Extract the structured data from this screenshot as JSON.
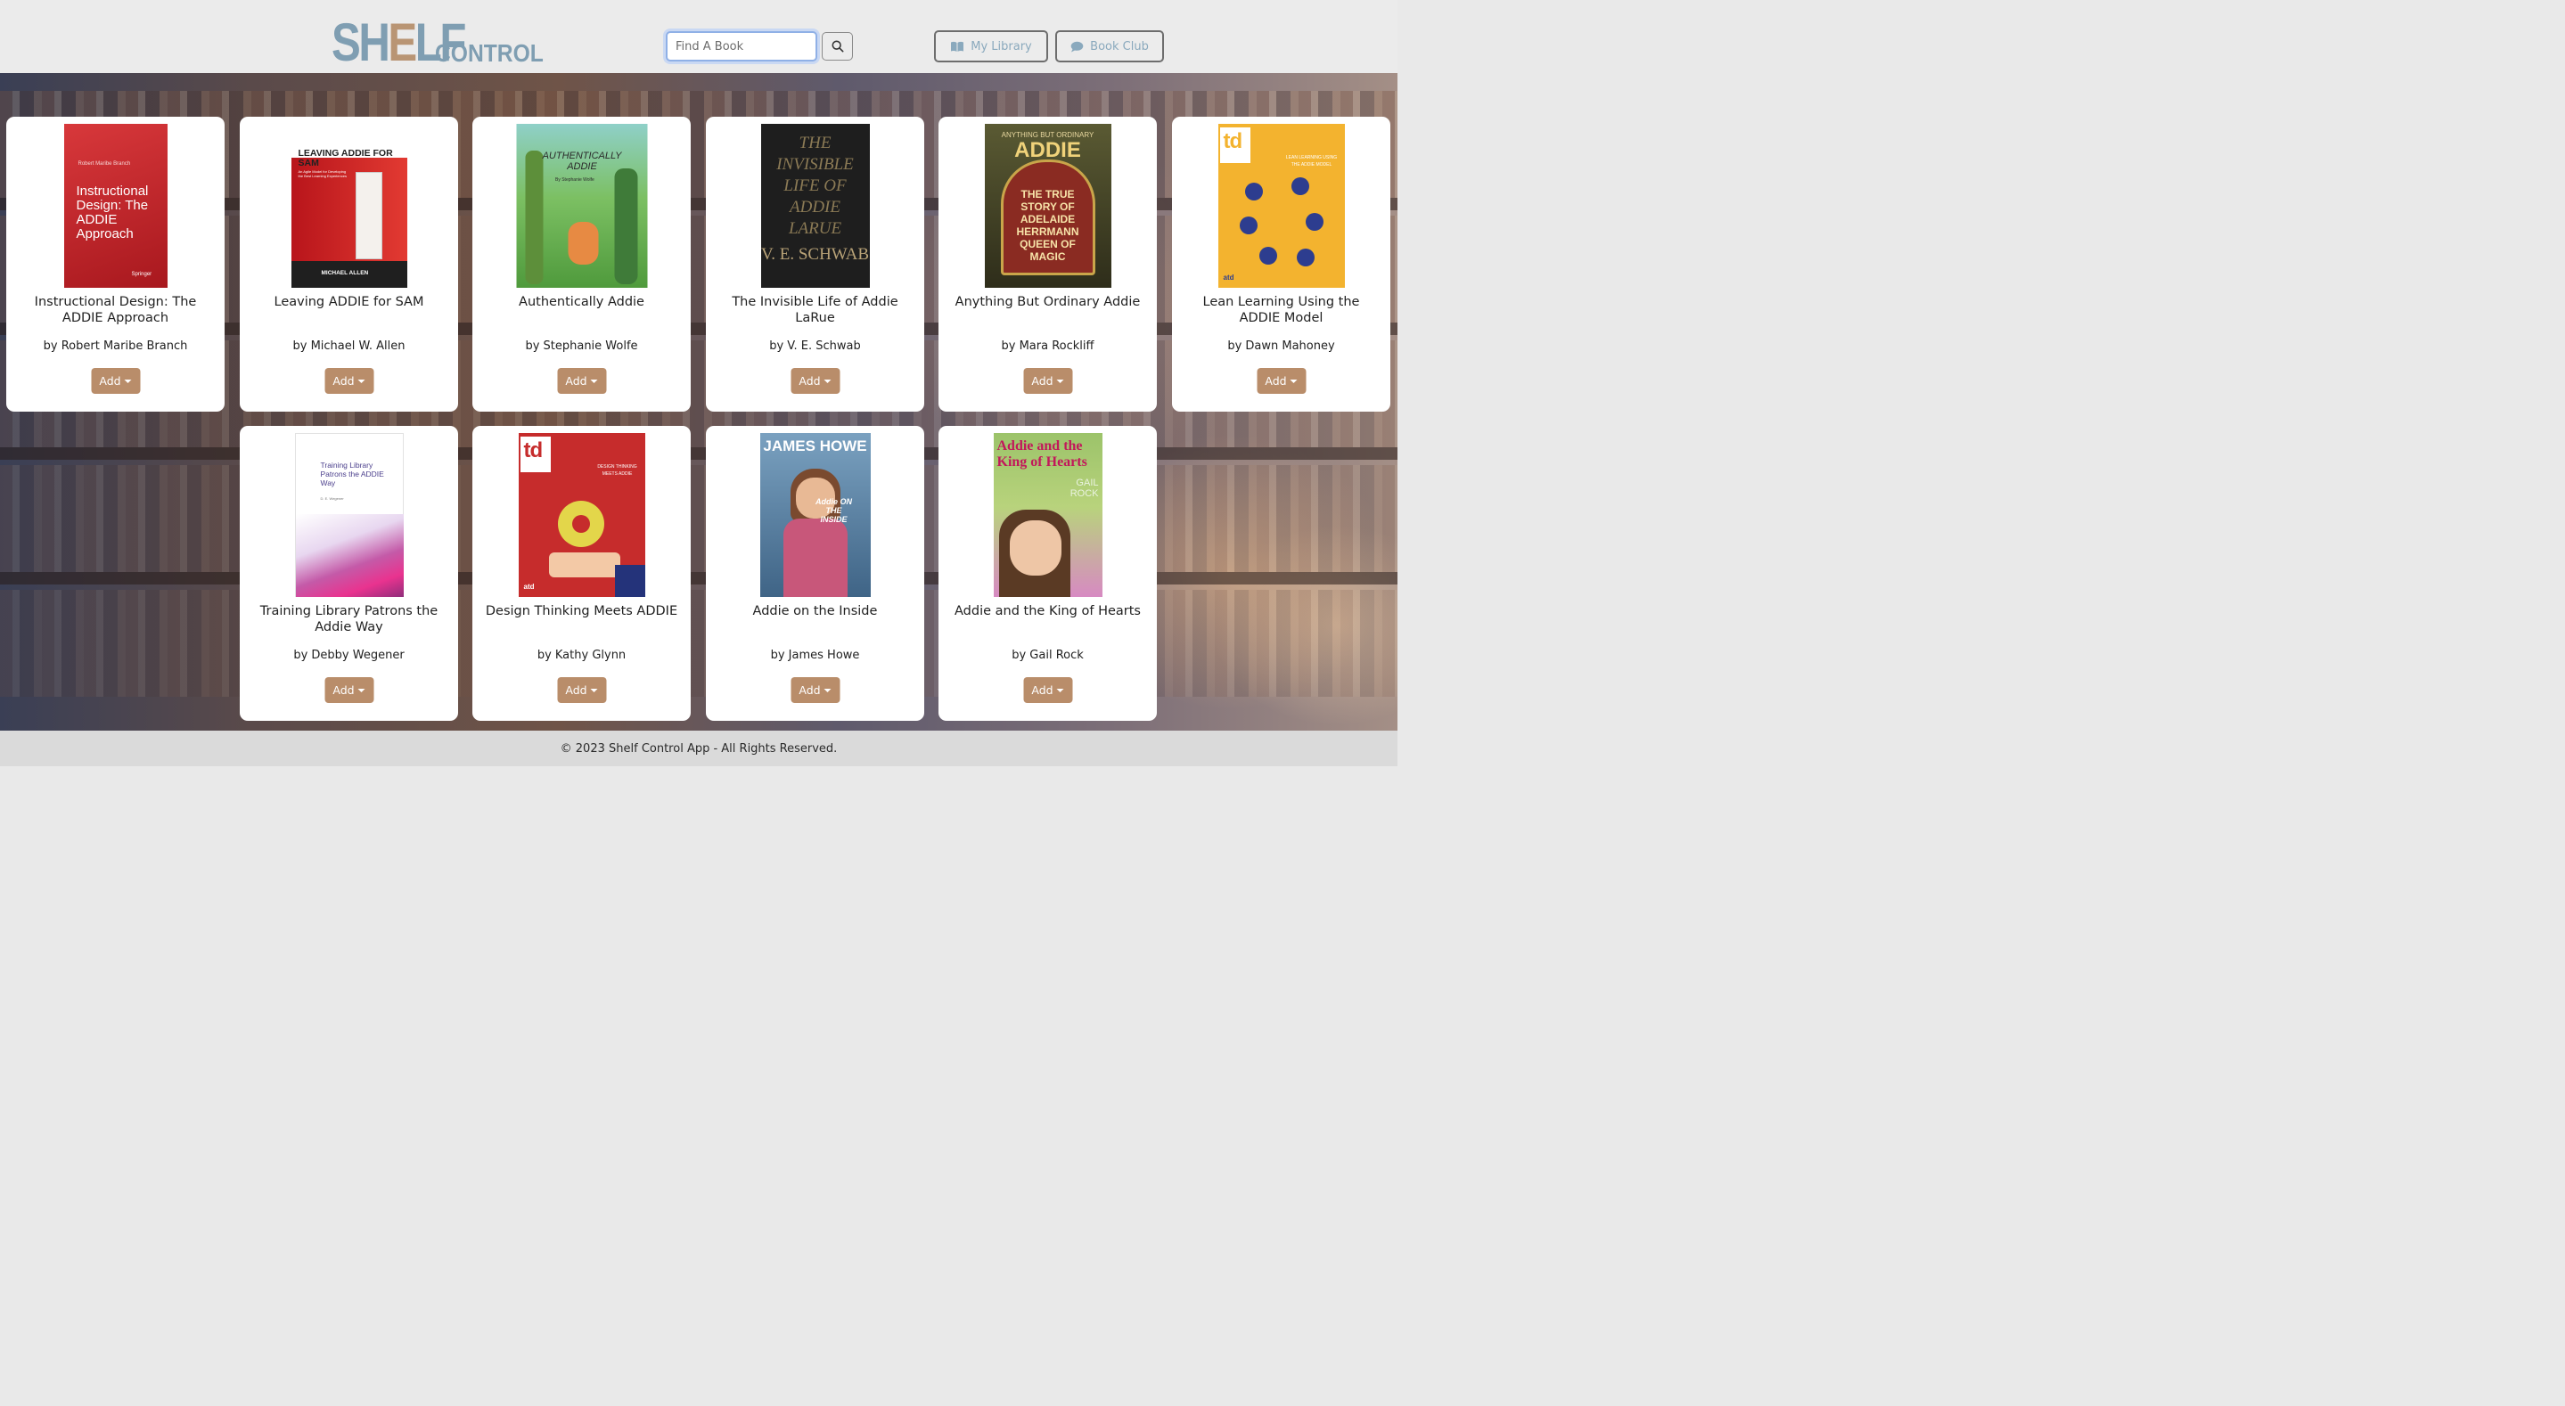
{
  "header": {
    "logo": {
      "big_left": "SH",
      "big_accent": "E",
      "big_right": "LF",
      "small": "CONTROL"
    },
    "search": {
      "placeholder": "Find A Book"
    },
    "nav": [
      {
        "label": "My Library",
        "icon": "book-open-icon"
      },
      {
        "label": "Book Club",
        "icon": "chat-bubble-icon"
      }
    ]
  },
  "books": [
    {
      "title": "Instructional Design: The ADDIE Approach",
      "author": "by Robert Maribe Branch",
      "add_label": "Add",
      "cover": {
        "bg": "#c4262b",
        "header": "Robert Maribe Branch",
        "title": "Instructional Design: The ADDIE Approach",
        "footer": "Springer"
      }
    },
    {
      "title": "Leaving ADDIE for SAM",
      "author": "by Michael W. Allen",
      "add_label": "Add",
      "cover": {
        "bg": "#d32b2b",
        "header": "LEAVING ADDIE FOR SAM",
        "subtitle": "An Agile Model for Developing the Best Learning Experiences",
        "footer": "MICHAEL ALLEN"
      }
    },
    {
      "title": "Authentically Addie",
      "author": "by Stephanie Wolfe",
      "add_label": "Add",
      "cover": {
        "bg": "#6fb45a",
        "header": "AUTHENTICALLY ADDIE",
        "subtitle": "By Stephanie Wolfe"
      }
    },
    {
      "title": "The Invisible Life of Addie LaRue",
      "author": "by V. E. Schwab",
      "add_label": "Add",
      "cover": {
        "bg": "#1c1c1c",
        "header": "THE INVISIBLE LIFE OF ADDIE LARUE",
        "footer": "V. E. SCHWAB"
      }
    },
    {
      "title": "Anything But Ordinary Addie",
      "author": "by Mara Rockliff",
      "add_label": "Add",
      "cover": {
        "bg": "#3d3a22",
        "header": "ANYTHING BUT ORDINARY",
        "title": "ADDIE",
        "subtitle": "THE TRUE STORY OF ADELAIDE HERRMANN QUEEN OF MAGIC"
      }
    },
    {
      "title": "Lean Learning Using the ADDIE Model",
      "author": "by Dawn Mahoney",
      "add_label": "Add",
      "cover": {
        "bg": "#f3b32f",
        "header": "td",
        "subtitle": "LEAN LEARNING USING THE ADDIE MODEL",
        "footer": "atd"
      }
    },
    {
      "title": "Training Library Patrons the Addie Way",
      "author": "by Debby Wegener",
      "add_label": "Add",
      "cover": {
        "bg": "#ffffff",
        "header": "Training Library Patrons the ADDIE Way",
        "subtitle": "D. E. Wegener"
      }
    },
    {
      "title": "Design Thinking Meets ADDIE",
      "author": "by Kathy Glynn",
      "add_label": "Add",
      "cover": {
        "bg": "#c62c2c",
        "header": "td",
        "subtitle": "DESIGN THINKING MEETS ADDIE",
        "footer": "atd"
      }
    },
    {
      "title": "Addie on the Inside",
      "author": "by James Howe",
      "add_label": "Add",
      "cover": {
        "bg": "#5f86a8",
        "header": "JAMES HOWE",
        "title": "Addie ON THE INSIDE"
      }
    },
    {
      "title": "Addie and the King of Hearts",
      "author": "by Gail Rock",
      "add_label": "Add",
      "cover": {
        "bg": "#b8d37c",
        "header": "Addie and the King of Hearts",
        "subtitle": "GAIL ROCK"
      }
    }
  ],
  "footer": {
    "text": "© 2023 Shelf Control App - All Rights Reserved."
  }
}
